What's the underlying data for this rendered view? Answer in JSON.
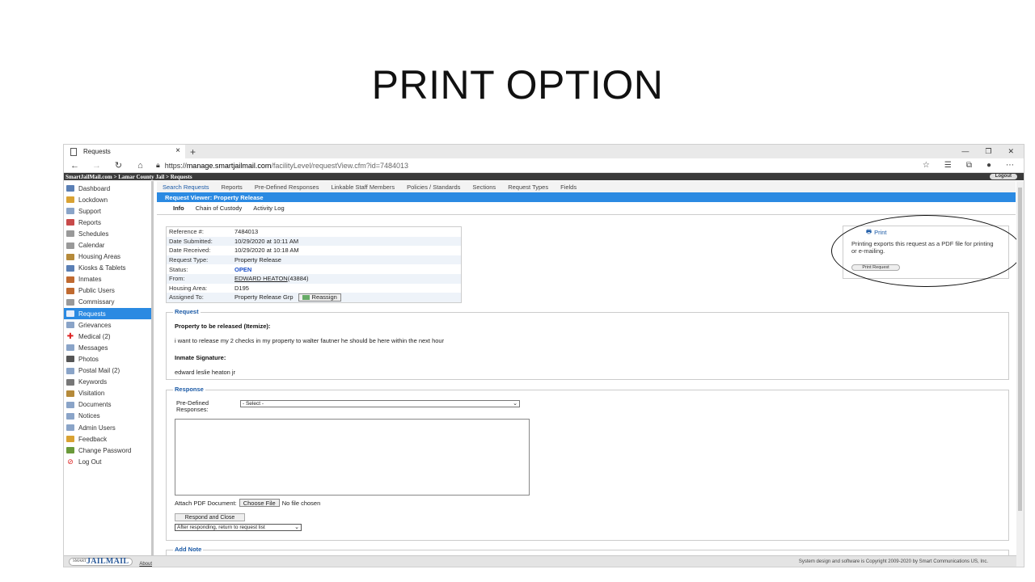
{
  "slide": {
    "title": "PRINT OPTION"
  },
  "browser": {
    "tab_title": "Requests",
    "url_prefix": "https://",
    "url_host": "manage.smartjailmail.com",
    "url_path": "/facilityLevel/requestView.cfm?id=7484013"
  },
  "site": {
    "breadcrumb": "SmartJailMail.com > Lamar County Jail > Requests",
    "logout": "Logout"
  },
  "sidebar": {
    "items": [
      {
        "label": "Dashboard",
        "icon": "dashboard-icon",
        "color": "#5a7fb5"
      },
      {
        "label": "Lockdown",
        "icon": "lock-icon",
        "color": "#d9a233"
      },
      {
        "label": "Support",
        "icon": "support-icon",
        "color": "#8aa4c8"
      },
      {
        "label": "Reports",
        "icon": "chart-icon",
        "color": "#c84a4a"
      },
      {
        "label": "Schedules",
        "icon": "schedule-icon",
        "color": "#999"
      },
      {
        "label": "Calendar",
        "icon": "calendar-icon",
        "color": "#999"
      },
      {
        "label": "Housing Areas",
        "icon": "house-icon",
        "color": "#b58a3a"
      },
      {
        "label": "Kiosks & Tablets",
        "icon": "kiosk-icon",
        "color": "#5a7fb5"
      },
      {
        "label": "Inmates",
        "icon": "inmate-icon",
        "color": "#c06a30"
      },
      {
        "label": "Public Users",
        "icon": "user-icon",
        "color": "#c06a30"
      },
      {
        "label": "Commissary",
        "icon": "cart-icon",
        "color": "#999"
      },
      {
        "label": "Requests",
        "icon": "requests-icon",
        "color": "#fff"
      },
      {
        "label": "Grievances",
        "icon": "grievance-icon",
        "color": "#8aa4c8"
      },
      {
        "label": "Medical (2)",
        "icon": "medical-cross-icon",
        "color": "#d22"
      },
      {
        "label": "Messages",
        "icon": "envelope-icon",
        "color": "#8aa4c8"
      },
      {
        "label": "Photos",
        "icon": "camera-icon",
        "color": "#555"
      },
      {
        "label": "Postal Mail (2)",
        "icon": "mail-icon",
        "color": "#8aa4c8"
      },
      {
        "label": "Keywords",
        "icon": "eye-icon",
        "color": "#777"
      },
      {
        "label": "Visitation",
        "icon": "visitation-icon",
        "color": "#b58a3a"
      },
      {
        "label": "Documents",
        "icon": "document-icon",
        "color": "#8aa4c8"
      },
      {
        "label": "Notices",
        "icon": "notice-icon",
        "color": "#8aa4c8"
      },
      {
        "label": "Admin Users",
        "icon": "admin-icon",
        "color": "#8aa4c8"
      },
      {
        "label": "Feedback",
        "icon": "feedback-icon",
        "color": "#d9a233"
      },
      {
        "label": "Change Password",
        "icon": "key-icon",
        "color": "#6a9a3a"
      },
      {
        "label": "Log Out",
        "icon": "logout-icon",
        "color": "#d22"
      }
    ]
  },
  "topnav": [
    "Search Requests",
    "Reports",
    "Pre-Defined Responses",
    "Linkable Staff Members",
    "Policies / Standards",
    "Sections",
    "Request Types",
    "Fields"
  ],
  "viewer": {
    "title": "Request Viewer: Property Release",
    "subtabs": [
      "Info",
      "Chain of Custody",
      "Activity Log"
    ]
  },
  "info": {
    "rows": [
      {
        "k": "Reference #:",
        "v": "7484013"
      },
      {
        "k": "Date Submitted:",
        "v": "10/29/2020 at 10:11 AM"
      },
      {
        "k": "Date Received:",
        "v": "10/29/2020 at 10:18 AM"
      },
      {
        "k": "Request Type:",
        "v": "Property Release"
      },
      {
        "k": "Status:",
        "v": "OPEN"
      },
      {
        "k": "From:",
        "v": "EDWARD HEATON"
      },
      {
        "k": "Housing Area:",
        "v": "D195"
      },
      {
        "k": "Assigned To:",
        "v": "Property Release Grp"
      }
    ],
    "from_id": " (43884)",
    "reassign": "Reassign"
  },
  "print": {
    "title": "Print",
    "description": "Printing exports this request as a PDF file for printing or e-mailing.",
    "button": "Print Request"
  },
  "request": {
    "legend": "Request",
    "label1": "Property to be released (Itemize):",
    "value1": "i want to release my 2 checks in my property to walter fautner he should be here within the next hour",
    "label2": "Inmate Signature:",
    "value2": "edward leslie heaton jr"
  },
  "response": {
    "legend": "Response",
    "predef_label": "Pre-Defined Responses:",
    "predef_value": "- Select -",
    "attach_label": "Attach PDF Document:",
    "choose_file": "Choose File",
    "no_file": "No file chosen",
    "respond_btn": "Respond and Close",
    "after_value": "After responding, return to request list"
  },
  "addnote": {
    "legend": "Add Note"
  },
  "footer": {
    "logo_a": "SMART",
    "logo_b": "JAILMAIL",
    "about": "About",
    "copyright": "System design and software is Copyright 2009-2020 by Smart Communications US, Inc."
  }
}
